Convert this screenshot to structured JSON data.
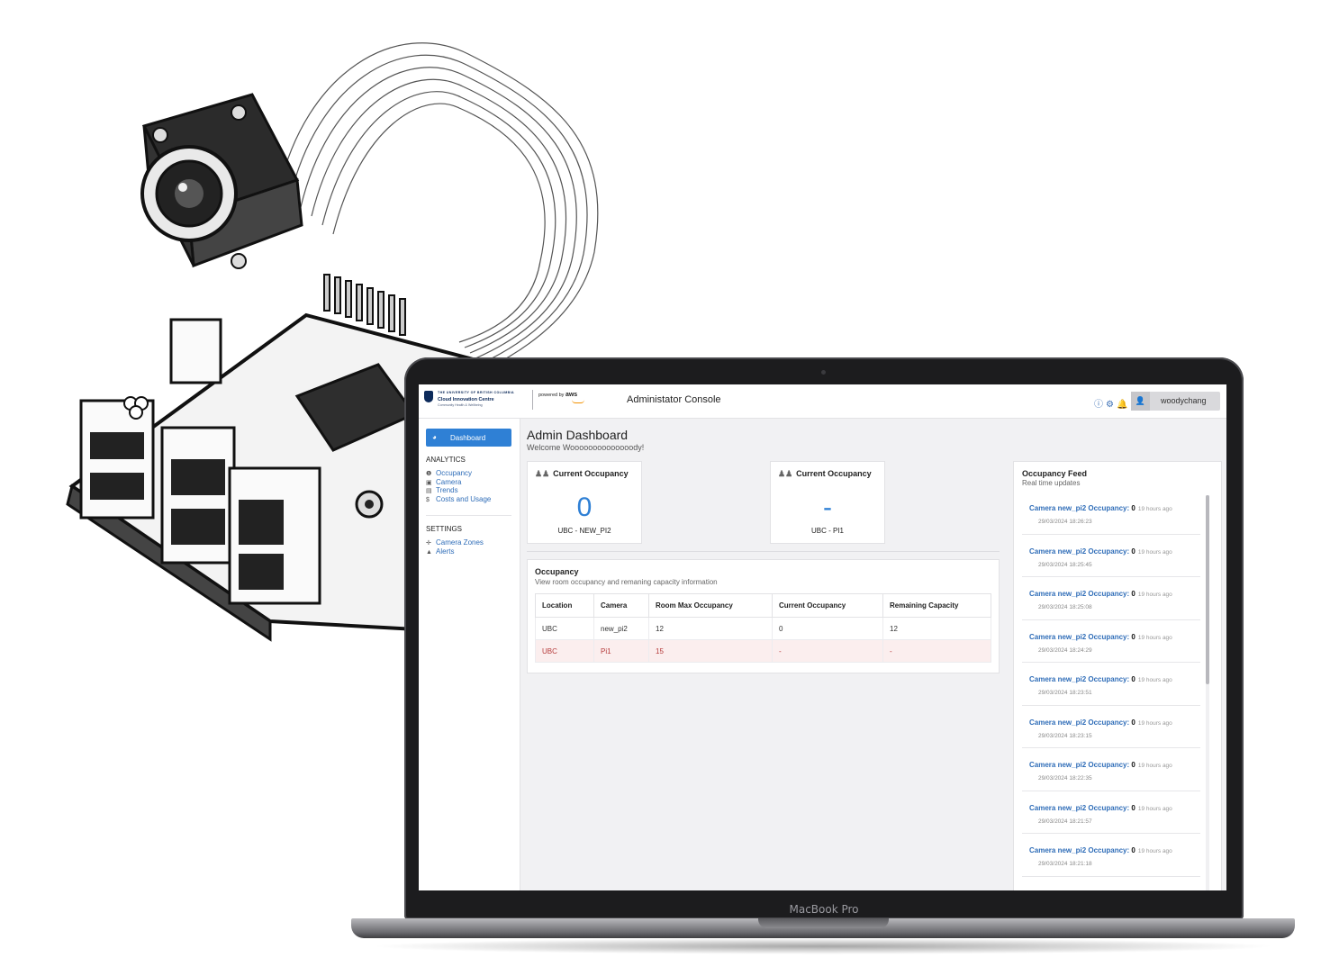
{
  "header": {
    "university_line": "THE UNIVERSITY OF BRITISH COLUMBIA",
    "centre_name": "Cloud Innovation Centre",
    "centre_sub": "Community Health & Wellbeing",
    "powered_by": "powered by",
    "aws": "aws",
    "title": "Administator Console",
    "username": "woodychang",
    "icons": [
      "help-icon",
      "gear-icon",
      "bell-icon",
      "user-icon"
    ]
  },
  "sidebar": {
    "dashboard_label": "Dashboard",
    "analytics_title": "ANALYTICS",
    "analytics_items": [
      "Occupancy",
      "Camera",
      "Trends",
      "Costs and Usage"
    ],
    "settings_title": "SETTINGS",
    "settings_items": [
      "Camera Zones",
      "Alerts"
    ]
  },
  "main": {
    "title": "Admin Dashboard",
    "welcome": "Welcome Woooooooooooooody!",
    "cards": [
      {
        "heading": "Current Occupancy",
        "value": "0",
        "location": "UBC - NEW_PI2"
      },
      {
        "heading": "Current Occupancy",
        "value": "-",
        "location": "UBC - PI1"
      }
    ],
    "occupancy_panel": {
      "title": "Occupancy",
      "subtitle": "View room occupancy and remaning capacity information",
      "columns": [
        "Location",
        "Camera",
        "Room Max Occupancy",
        "Current Occupancy",
        "Remaining Capacity"
      ],
      "rows": [
        [
          "UBC",
          "new_pi2",
          "12",
          "0",
          "12"
        ],
        [
          "UBC",
          "Pi1",
          "15",
          "-",
          "-"
        ]
      ]
    }
  },
  "feed": {
    "title": "Occupancy Feed",
    "subtitle": "Real time updates",
    "items": [
      {
        "camera": "Camera new_pi2 Occupancy:",
        "count": "0",
        "ago": "19 hours ago",
        "time": "29/03/2024 18:26:23"
      },
      {
        "camera": "Camera new_pi2 Occupancy:",
        "count": "0",
        "ago": "19 hours ago",
        "time": "29/03/2024 18:25:45"
      },
      {
        "camera": "Camera new_pi2 Occupancy:",
        "count": "0",
        "ago": "19 hours ago",
        "time": "29/03/2024 18:25:08"
      },
      {
        "camera": "Camera new_pi2 Occupancy:",
        "count": "0",
        "ago": "19 hours ago",
        "time": "29/03/2024 18:24:29"
      },
      {
        "camera": "Camera new_pi2 Occupancy:",
        "count": "0",
        "ago": "19 hours ago",
        "time": "29/03/2024 18:23:51"
      },
      {
        "camera": "Camera new_pi2 Occupancy:",
        "count": "0",
        "ago": "19 hours ago",
        "time": "29/03/2024 18:23:15"
      },
      {
        "camera": "Camera new_pi2 Occupancy:",
        "count": "0",
        "ago": "19 hours ago",
        "time": "29/03/2024 18:22:35"
      },
      {
        "camera": "Camera new_pi2 Occupancy:",
        "count": "0",
        "ago": "19 hours ago",
        "time": "29/03/2024 18:21:57"
      },
      {
        "camera": "Camera new_pi2 Occupancy:",
        "count": "0",
        "ago": "19 hours ago",
        "time": "29/03/2024 18:21:18"
      }
    ]
  },
  "device": {
    "brand": "MacBook Pro"
  },
  "colors": {
    "accent": "#2f80d5",
    "link": "#2f6db8",
    "alert_row_bg": "#fbeeee",
    "alert_text": "#b53a3a"
  }
}
